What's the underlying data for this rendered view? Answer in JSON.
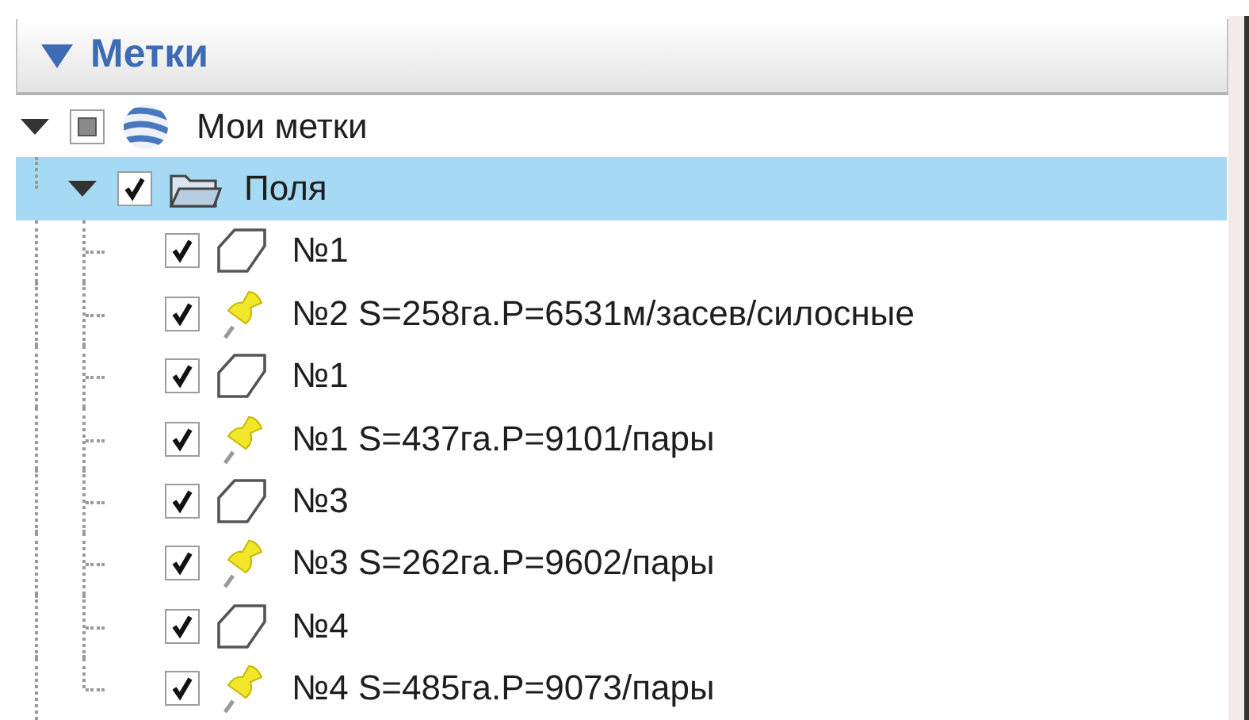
{
  "panel": {
    "title": "Метки",
    "expanded": true
  },
  "tree": [
    {
      "label": "Мои метки",
      "kind": "globe",
      "checked": false,
      "partial": true,
      "expanded": true,
      "selected": false,
      "children": [
        {
          "label": "Поля",
          "kind": "folder",
          "checked": true,
          "expanded": true,
          "selected": true,
          "children": [
            {
              "label": "№1",
              "kind": "polygon",
              "checked": true,
              "selected": false
            },
            {
              "label": "№2 S=258га.P=6531м/засев/силосные",
              "kind": "placemark",
              "checked": true,
              "selected": false
            },
            {
              "label": "№1",
              "kind": "polygon",
              "checked": true,
              "selected": false
            },
            {
              "label": "№1 S=437га.P=9101/пары",
              "kind": "placemark",
              "checked": true,
              "selected": false
            },
            {
              "label": "№3",
              "kind": "polygon",
              "checked": true,
              "selected": false
            },
            {
              "label": "№3 S=262га.P=9602/пары",
              "kind": "placemark",
              "checked": true,
              "selected": false
            },
            {
              "label": "№4",
              "kind": "polygon",
              "checked": true,
              "selected": false
            },
            {
              "label": "№4 S=485га.P=9073/пары",
              "kind": "placemark",
              "checked": true,
              "selected": false
            }
          ]
        }
      ]
    }
  ]
}
